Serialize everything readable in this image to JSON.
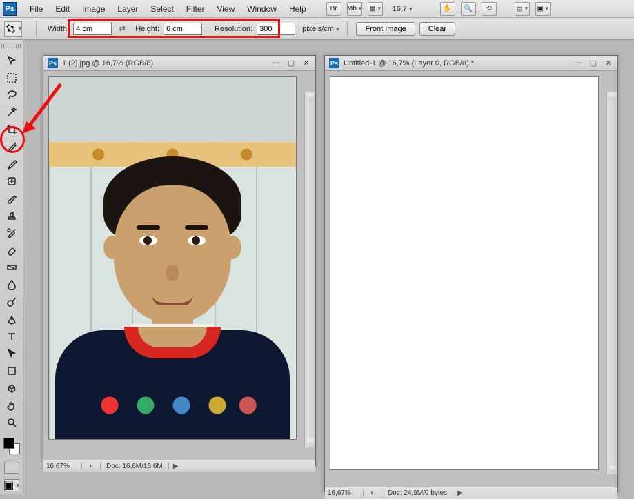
{
  "menu": {
    "items": [
      "File",
      "Edit",
      "Image",
      "Layer",
      "Select",
      "Filter",
      "View",
      "Window",
      "Help"
    ],
    "zoom_display": "16,7",
    "br_label": "Br",
    "mb_label": "Mb"
  },
  "options_bar": {
    "width_label": "Width:",
    "width_value": "4 cm",
    "height_label": "Height:",
    "height_value": "6 cm",
    "resolution_label": "Resolution:",
    "resolution_value": "300",
    "units": "pixels/cm",
    "front_image": "Front Image",
    "clear": "Clear"
  },
  "tools": [
    "move",
    "marquee",
    "lasso",
    "wand",
    "crop",
    "slice",
    "eyedropper",
    "spot-heal",
    "brush",
    "clone",
    "history-brush",
    "eraser",
    "gradient",
    "blur",
    "dodge",
    "pen",
    "type",
    "path-select",
    "shape",
    "3d",
    "hand",
    "zoom"
  ],
  "doc1": {
    "title": "1 (2).jpg @ 16,7% (RGB/8)",
    "zoom": "16,67%",
    "docinfo": "Doc: 16,6M/16,6M"
  },
  "doc2": {
    "title": "Untitled-1 @ 16,7% (Layer 0, RGB/8) *",
    "zoom": "16,67%",
    "docinfo": "Doc: 24,9M/0 bytes"
  }
}
